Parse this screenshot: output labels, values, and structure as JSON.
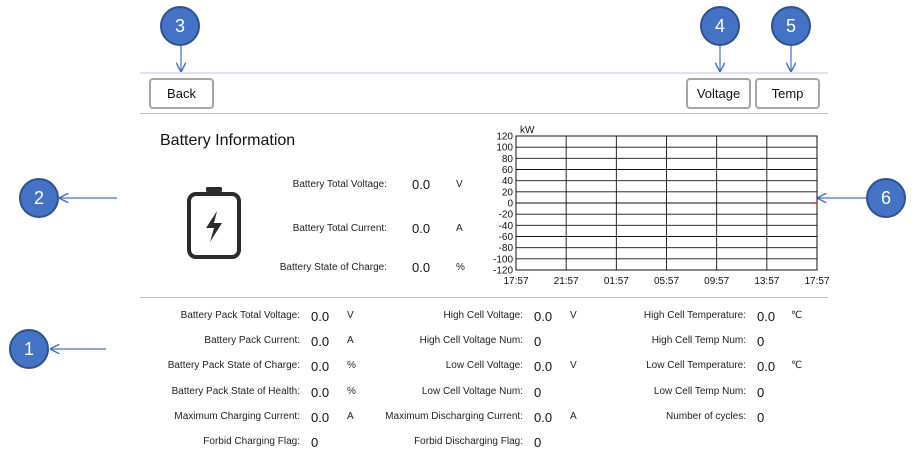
{
  "callouts": [
    "3",
    "4",
    "5",
    "2",
    "6",
    "1"
  ],
  "toolbar": {
    "back_label": "Back",
    "voltage_label": "Voltage",
    "temp_label": "Temp"
  },
  "battery": {
    "title": "Battery Information",
    "summary": [
      {
        "label": "Battery Total Voltage:",
        "value": "0.0",
        "unit": "V"
      },
      {
        "label": "Battery Total Current:",
        "value": "0.0",
        "unit": "A"
      },
      {
        "label": "Battery State of Charge:",
        "value": "0.0",
        "unit": "%"
      }
    ]
  },
  "chart_data": {
    "type": "line",
    "ylabel": "kW",
    "ylim": [
      -120,
      120
    ],
    "y_ticks": [
      "120",
      "100",
      "80",
      "60",
      "40",
      "20",
      "0",
      "-20",
      "-40",
      "-60",
      "-80",
      "-100",
      "-120"
    ],
    "x_ticks": [
      "17:57",
      "21:57",
      "01:57",
      "05:57",
      "09:57",
      "13:57",
      "17:57"
    ],
    "grid": true,
    "series": [
      {
        "values": [
          0,
          0
        ],
        "color": "#e02020"
      }
    ]
  },
  "details": {
    "col1": [
      {
        "label": "Battery Pack Total Voltage:",
        "value": "0.0",
        "unit": "V"
      },
      {
        "label": "Battery Pack Current:",
        "value": "0.0",
        "unit": "A"
      },
      {
        "label": "Battery Pack State of Charge:",
        "value": "0.0",
        "unit": "%"
      },
      {
        "label": "Battery Pack State of Health:",
        "value": "0.0",
        "unit": "%"
      },
      {
        "label": "Maximum Charging Current:",
        "value": "0.0",
        "unit": "A"
      },
      {
        "label": "Forbid Charging Flag:",
        "value": "0",
        "unit": ""
      }
    ],
    "col2": [
      {
        "label": "High Cell Voltage:",
        "value": "0.0",
        "unit": "V"
      },
      {
        "label": "High Cell Voltage Num:",
        "value": "0",
        "unit": ""
      },
      {
        "label": "Low Cell Voltage:",
        "value": "0.0",
        "unit": "V"
      },
      {
        "label": "Low Cell Voltage Num:",
        "value": "0",
        "unit": ""
      },
      {
        "label": "Maximum Discharging Current:",
        "value": "0.0",
        "unit": "A"
      },
      {
        "label": "Forbid Discharging Flag:",
        "value": "0",
        "unit": ""
      }
    ],
    "col3": [
      {
        "label": "High Cell Temperature:",
        "value": "0.0",
        "unit": "℃"
      },
      {
        "label": "High Cell Temp Num:",
        "value": "0",
        "unit": ""
      },
      {
        "label": "Low Cell Temperature:",
        "value": "0.0",
        "unit": "℃"
      },
      {
        "label": "Low Cell Temp Num:",
        "value": "0",
        "unit": ""
      },
      {
        "label": "Number of cycles:",
        "value": "0",
        "unit": ""
      }
    ]
  }
}
